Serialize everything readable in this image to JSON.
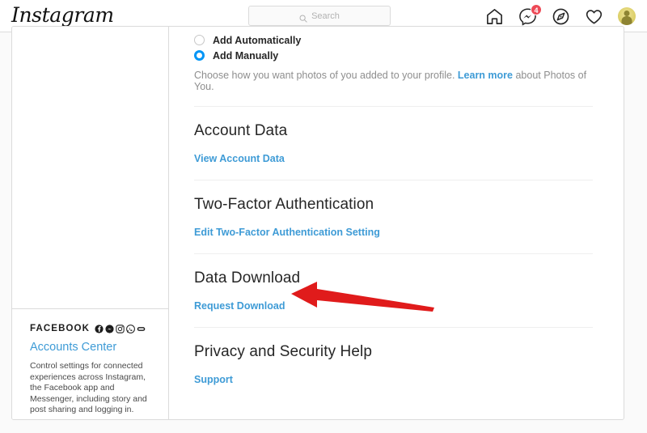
{
  "nav": {
    "logo": "Instagram",
    "search": {
      "placeholder": "Search",
      "value": "",
      "icon": "search-icon"
    },
    "icons": [
      {
        "name": "home-icon",
        "label": "Home"
      },
      {
        "name": "messenger-icon",
        "label": "Messenger",
        "badge": "4"
      },
      {
        "name": "explore-icon",
        "label": "Explore"
      },
      {
        "name": "heart-icon",
        "label": "Activity"
      }
    ],
    "avatar_label": "Profile"
  },
  "sidebar": {
    "facebook": {
      "word": "FACEBOOK",
      "icons": [
        "facebook-icon",
        "messenger-icon",
        "instagram-icon",
        "whatsapp-icon",
        "portal-icon"
      ],
      "link": "Accounts Center",
      "description": "Control settings for connected experiences across Instagram, the Facebook app and Messenger, including story and post sharing and logging in."
    }
  },
  "main": {
    "photos_of_you": {
      "options": [
        {
          "label": "Add Automatically",
          "selected": false
        },
        {
          "label": "Add Manually",
          "selected": true
        }
      ],
      "helper_before": "Choose how you want photos of you added to your profile. ",
      "helper_link": "Learn more",
      "helper_after": " about Photos of You."
    },
    "sections": [
      {
        "title": "Account Data",
        "link": "View Account Data"
      },
      {
        "title": "Two-Factor Authentication",
        "link": "Edit Two-Factor Authentication Setting"
      },
      {
        "title": "Data Download",
        "link": "Request Download"
      },
      {
        "title": "Privacy and Security Help",
        "link": "Support"
      }
    ]
  },
  "annotation": {
    "type": "arrow",
    "color": "#e01b1b",
    "points_to": "Request Download"
  },
  "colors": {
    "link_blue": "#3e9bd6",
    "radio_blue": "#0095f6",
    "badge_red": "#ed4956",
    "arrow_red": "#e01b1b",
    "text": "#262626",
    "muted": "#8e8e8e",
    "border": "#dbdbdb",
    "page_bg": "#fafafa"
  }
}
